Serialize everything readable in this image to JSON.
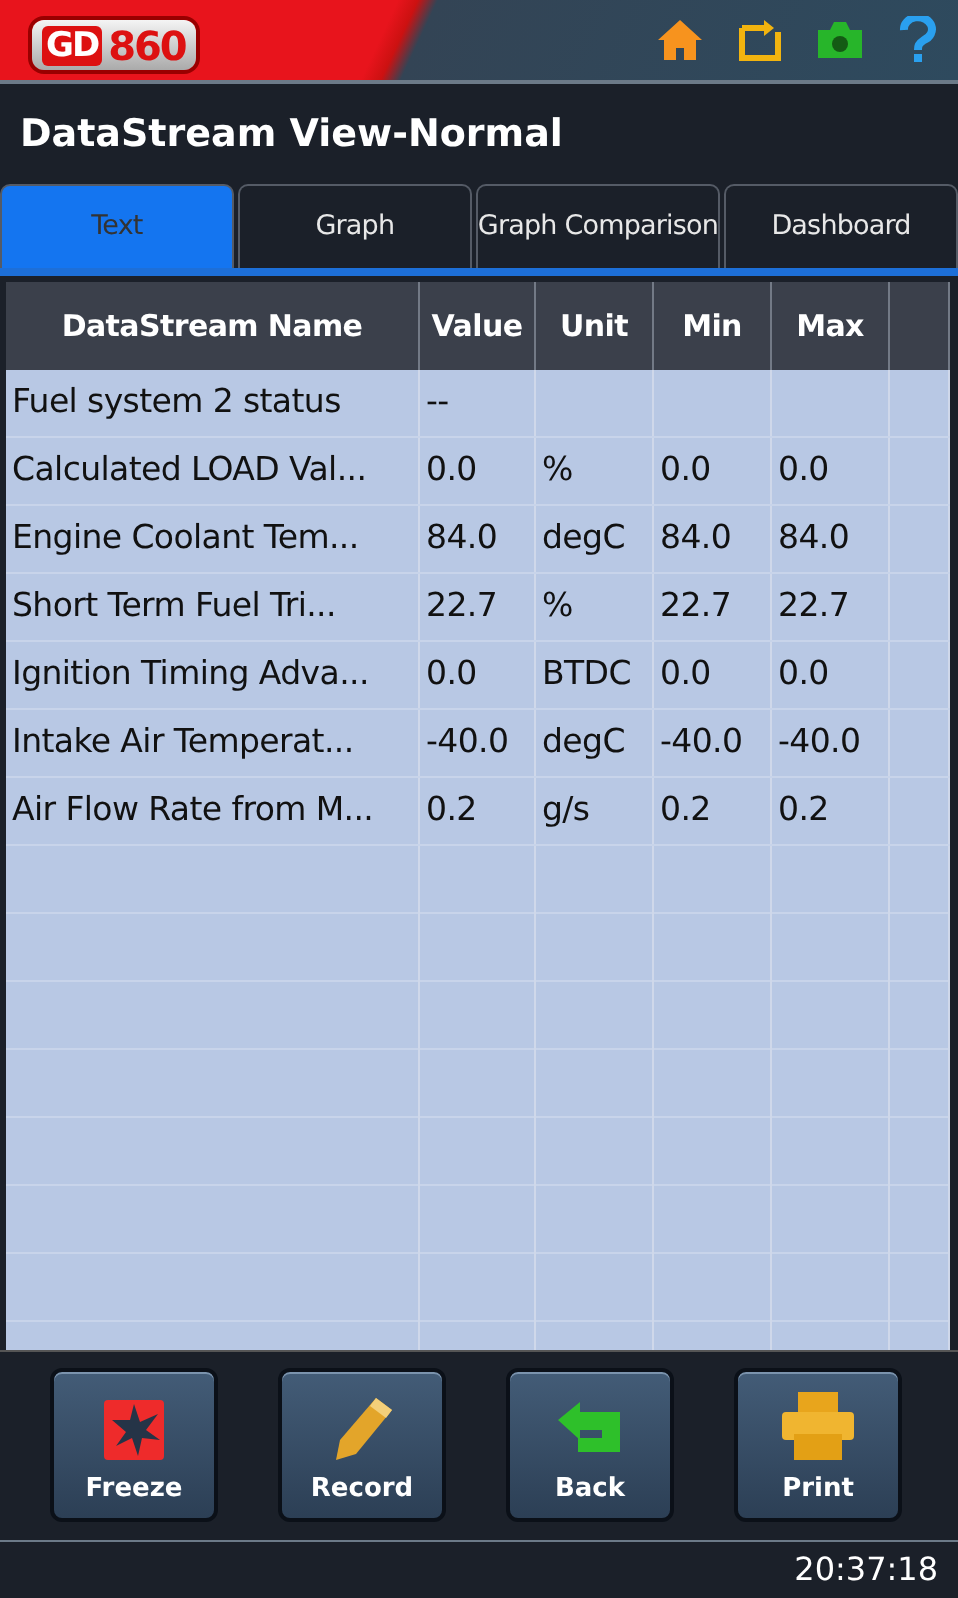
{
  "header": {
    "logo": [
      "GD",
      "860"
    ]
  },
  "title": "DataStream View-Normal",
  "tabs": [
    {
      "label": "Text",
      "selected": true
    },
    {
      "label": "Graph",
      "selected": false
    },
    {
      "label": "Graph Comparison",
      "selected": false
    },
    {
      "label": "Dashboard",
      "selected": false
    }
  ],
  "table": {
    "columns": [
      "DataStream Name",
      "Value",
      "Unit",
      "Min",
      "Max"
    ],
    "rows": [
      [
        "Fuel system 2 status",
        "--",
        "",
        "",
        ""
      ],
      [
        "Calculated LOAD Val...",
        "0.0",
        "%",
        "0.0",
        "0.0"
      ],
      [
        "Engine Coolant Tem...",
        "84.0",
        "degC",
        "84.0",
        "84.0"
      ],
      [
        "Short Term Fuel Tri...",
        "22.7",
        "%",
        "22.7",
        "22.7"
      ],
      [
        "Ignition Timing Adva...",
        "0.0",
        "BTDC",
        "0.0",
        "0.0"
      ],
      [
        "Intake Air Temperat...",
        "-40.0",
        "degC",
        "-40.0",
        "-40.0"
      ],
      [
        "Air Flow Rate from M...",
        "0.2",
        "g/s",
        "0.2",
        "0.2"
      ]
    ]
  },
  "buttons": [
    {
      "kind": "freeze",
      "label": "Freeze"
    },
    {
      "kind": "record",
      "label": "Record"
    },
    {
      "kind": "back",
      "label": "Back"
    },
    {
      "kind": "print",
      "label": "Print"
    }
  ],
  "status_bar": {
    "time": "20:37:18"
  }
}
